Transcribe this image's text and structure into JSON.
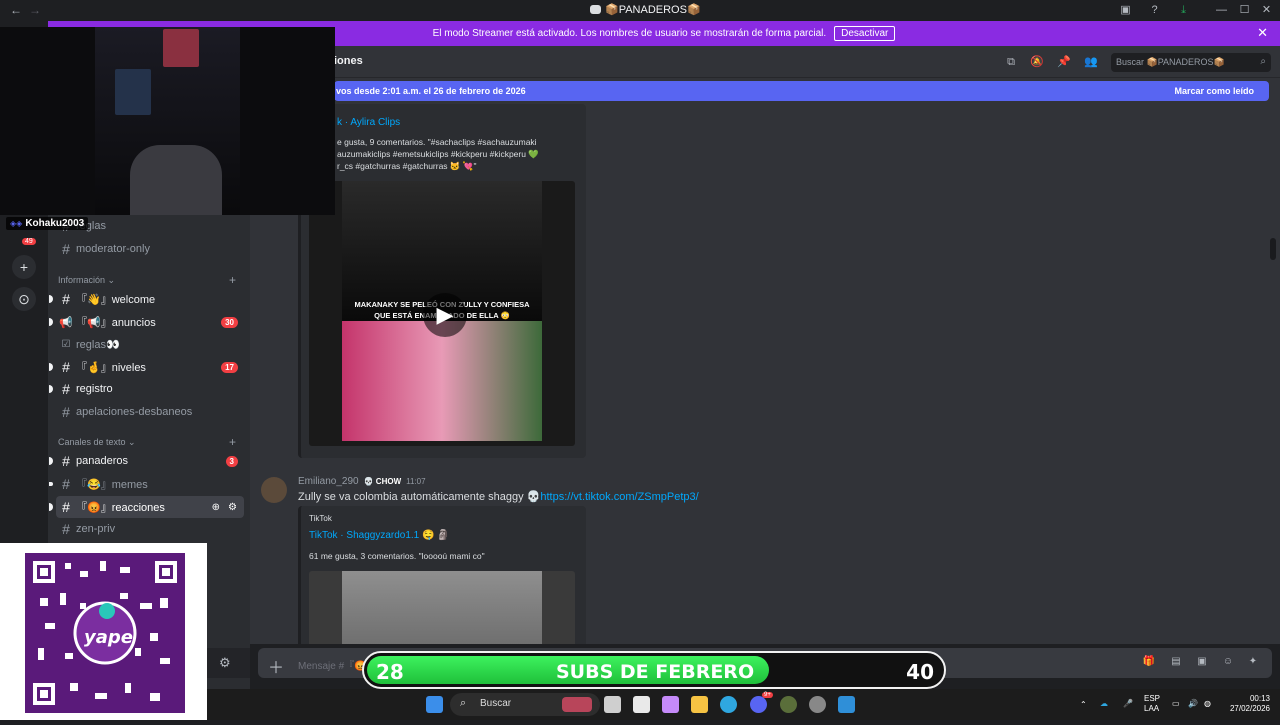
{
  "titlebar": {
    "back": "←",
    "forward": "→",
    "title": "📦PANADEROS📦",
    "min": "—",
    "max": "☐",
    "close": "✕"
  },
  "banner": {
    "text": "El modo Streamer está activado. Los nombres de usuario se mostrarán de forma parcial.",
    "button": "Desactivar",
    "close": "✕"
  },
  "guilds": {
    "user_tag": "Kohaku2003",
    "mention_count": "49"
  },
  "channels": {
    "top": [
      {
        "name": "reglas",
        "kind": "text"
      },
      {
        "name": "moderator-only",
        "kind": "text"
      }
    ],
    "cat_info": "Información",
    "info_items": [
      {
        "name": "『👋』welcome",
        "unread": true,
        "badge": ""
      },
      {
        "name": "『📢』anuncios",
        "unread": true,
        "badge": "30"
      },
      {
        "name": "reglas👀",
        "unread": false,
        "badge": ""
      },
      {
        "name": "『🤞』niveles",
        "unread": true,
        "badge": "17"
      },
      {
        "name": "registro",
        "unread": true,
        "badge": ""
      },
      {
        "name": "apelaciones-desbaneos",
        "unread": false,
        "badge": ""
      }
    ],
    "cat_text": "Canales de texto",
    "text_items": [
      {
        "name": "panaderos",
        "unread": true,
        "badge": "3"
      },
      {
        "name": "『😂』memes",
        "unread": false,
        "badge": ""
      },
      {
        "name": "『😡』reacciones",
        "unread": true,
        "badge": "",
        "active": true
      },
      {
        "name": "zen-priv",
        "unread": false,
        "badge": ""
      }
    ]
  },
  "header": {
    "channel_name": "iones",
    "search_placeholder": "Buscar 📦PANADEROS📦"
  },
  "newbar": {
    "left": "vos desde 2:01 a.m. el 26 de febrero de 2026",
    "right": "Marcar como leído"
  },
  "embed1": {
    "title": "k · Aylira Clips",
    "desc_lines": [
      "e gusta, 9 comentarios. \"#sachaclips #sachauzumaki",
      "auzumakiclips #emetsukiclips #kickperu #kickperu 💚",
      "r_cs #gatchurras #gatchurras 🐱 💘\""
    ],
    "video_caption_1": "MAKANAKY SE PELEÓ CON ZULLY Y CONFIESA",
    "video_caption_2": "QUE ESTÁ ENAMORADO DE ELLA 😳",
    "play": "▶"
  },
  "message2": {
    "username": "Emiliano_290",
    "role_tag": "CHOW",
    "time": "11:07",
    "text": "Zully se va colombia automáticamente shaggy 💀",
    "link": "https://vt.tiktok.com/ZSmpPetp3/"
  },
  "embed2": {
    "provider": "TikTok",
    "title": "TikTok · Shaggyzardo1.1 🤤 🗿",
    "desc": "61 me gusta, 3 comentarios. \"looooú mami co\""
  },
  "composer": {
    "placeholder": "Mensaje #『😡』",
    "plus": "＋"
  },
  "qr": {
    "brand": "yape"
  },
  "subgoal": {
    "current": "28",
    "label": "SUBS DE FEBRERO",
    "goal": "40",
    "progress": 0.7
  },
  "taskbar": {
    "search": "Buscar",
    "lang_top": "ESP",
    "lang_bottom": "LAA",
    "time": "00:13",
    "date": "27/02/2026",
    "discord_badge": "9+"
  },
  "colors": {
    "streamer_banner": "#8a2be2",
    "blurple": "#5865f2",
    "link": "#00a8fc",
    "badge": "#f23f43",
    "progress_green": "#3df25e"
  }
}
